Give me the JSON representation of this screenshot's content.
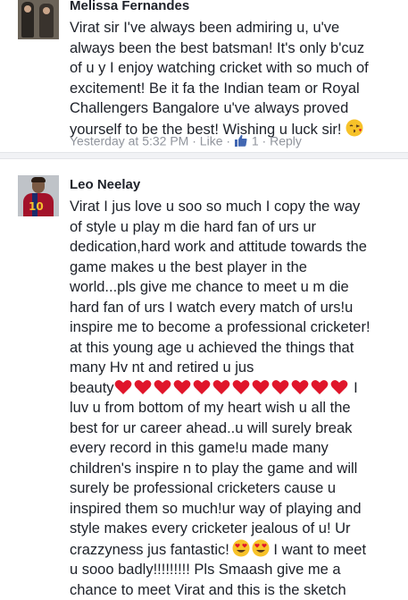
{
  "comments": [
    {
      "author": "Melissa Fernandes",
      "lines": [
        "Virat sir I've always been admiring u, u've",
        "always been the best batsman! It's only b'cuz",
        "of u y I enjoy watching cricket with so much of",
        "excitement! Be it fa the Indian team or Royal",
        "Challengers Bangalore u've always proved",
        "yourself to be the best! Wishing u luck sir!"
      ],
      "emoji": "kissing-face",
      "timestamp": "Yesterday at 5:32 PM",
      "sep": "·",
      "like_label": "Like",
      "like_count": "1",
      "reply_label": "Reply"
    },
    {
      "author": "Leo Neelay",
      "avatar_number": "10",
      "lines": [
        "Virat I jus love u soo so much I copy the way",
        "of style u play m die hard fan of urs ur",
        "dedication,hard work and attitude towards the",
        "game makes u the best player in the",
        "world...pls give me chance to meet u m die",
        "hard fan of urs I watch every match of urs!u",
        "inspire me to become a professional cricketer!",
        "at this young age u achieved the things that",
        "many Hv nt and retired u jus"
      ],
      "heart_line": {
        "before": "beauty",
        "hearts": 12,
        "after": "I"
      },
      "lines2": [
        "luv u from bottom of my heart wish u all the",
        "best for ur career ahead..u will surely break",
        "every record in this game!u made many",
        "children's inspire n to play the game and will",
        "surely be professional cricketers cause u",
        "inspired them so much!ur way of playing and",
        "style makes every cricketer jealous of u! Ur"
      ],
      "emoji_line": {
        "before": "crazzyness jus fantastic!",
        "emoji": "heart-eyes",
        "count": 2,
        "after": "I want to meet"
      },
      "lines3": [
        "u sooo badly!!!!!!!!! Pls Smaash give me a",
        "chance to meet Virat and this is the sketch"
      ]
    }
  ],
  "colors": {
    "text": "#1d2129",
    "meta": "#90949c",
    "link": "#4267b2",
    "heart": "#e0162b",
    "emoji": "#f7c229"
  }
}
